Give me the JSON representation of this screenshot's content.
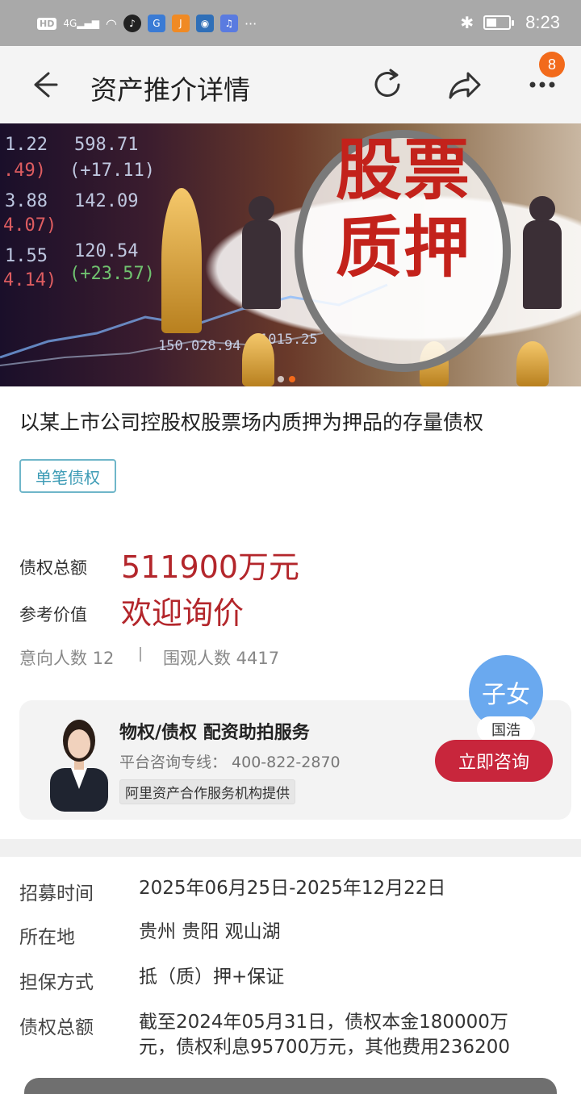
{
  "status_bar": {
    "network_badge": "HD",
    "signal": "4G",
    "time": "8:23"
  },
  "header": {
    "title": "资产推介详情",
    "badge_count": "8",
    "icons": [
      "back-arrow-icon",
      "refresh-icon",
      "share-icon",
      "more-icon"
    ]
  },
  "banner": {
    "headline_line1": "股票",
    "headline_line2": "质押",
    "tickers": [
      "1.22",
      "598.71",
      ".49)",
      "(+17.11)",
      "3.88",
      "142.09",
      "4.07)",
      "1.55",
      "120.54",
      "4.14)",
      "(+23.57)",
      "150.028.94",
      "1015.25"
    ],
    "slides_count": 2,
    "active_slide": 2
  },
  "asset": {
    "title": "以某上市公司控股权股票场内质押为押品的存量债权",
    "tag": "单笔债权",
    "total_label": "债权总额",
    "total_value": "511900万元",
    "ref_label": "参考价值",
    "ref_value": "欢迎询价",
    "intent_count": "意向人数 12",
    "view_count": "围观人数 4417"
  },
  "service_card": {
    "title": "物权/债权  配资助拍服务",
    "phone": "平台咨询专线： 400-822-2870",
    "provider": "阿里资产合作服务机构提供",
    "button": "立即咨询",
    "agent_avatar_text": "子女",
    "agent_name": "国浩"
  },
  "details": [
    {
      "label": "招募时间",
      "value": "2025年06月25日-2025年12月22日"
    },
    {
      "label": "所在地",
      "value": "贵州 贵阳 观山湖"
    },
    {
      "label": "担保方式",
      "value": "抵（质）押+保证"
    },
    {
      "label": "债权总额",
      "value": "截至2024年05月31日，债权本金180000万元，债权利息95700万元，其他费用236200"
    }
  ],
  "colors": {
    "accent_red": "#b3262b",
    "button_red": "#c8263c",
    "tag_blue": "#3c9bb5",
    "badge_orange": "#f26a1b",
    "agent_blue": "#6aa9ef"
  }
}
